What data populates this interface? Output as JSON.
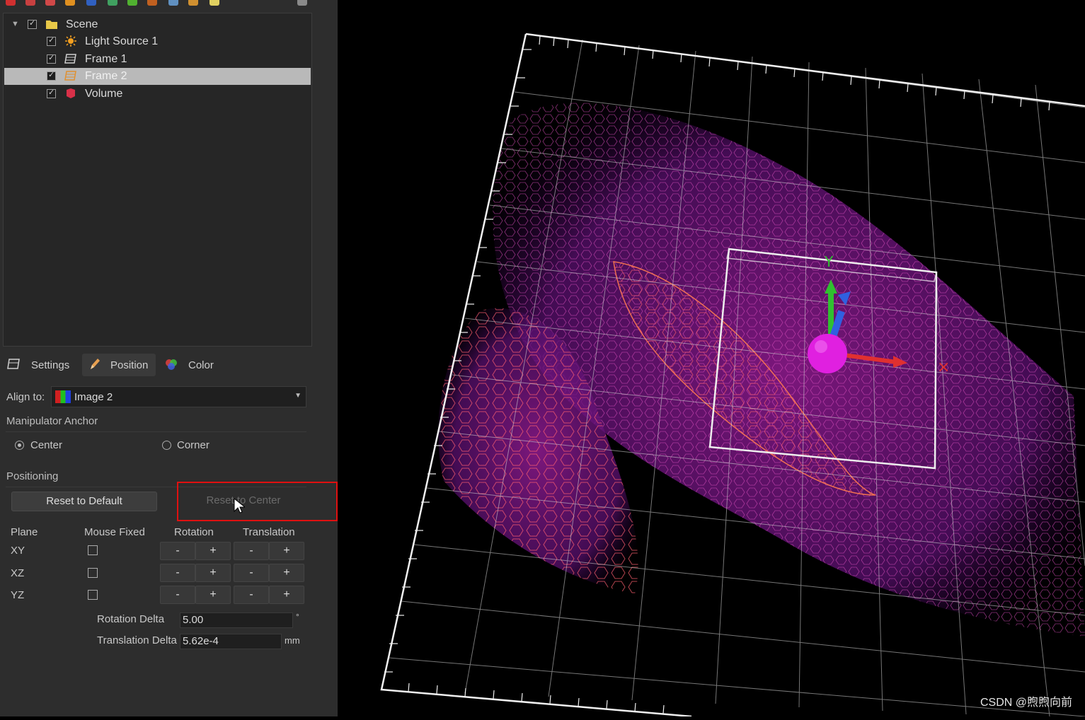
{
  "scene_tree": {
    "items": [
      {
        "label": "Scene",
        "checked": true,
        "icon": "folder-icon"
      },
      {
        "label": "Light Source 1",
        "checked": true,
        "icon": "light-source-icon"
      },
      {
        "label": "Frame 1",
        "checked": true,
        "icon": "frame-icon"
      },
      {
        "label": "Frame 2",
        "checked": true,
        "icon": "frame-icon",
        "selected": true
      },
      {
        "label": "Volume",
        "checked": true,
        "icon": "volume-icon"
      }
    ]
  },
  "tabs": [
    {
      "label": "Settings",
      "icon": "settings-icon"
    },
    {
      "label": "Position",
      "icon": "pencil-icon",
      "active": true
    },
    {
      "label": "Color",
      "icon": "color-wheel-icon"
    }
  ],
  "align": {
    "label": "Align to:",
    "value": "Image 2"
  },
  "anchor": {
    "title": "Manipulator Anchor",
    "options": [
      "Center",
      "Corner"
    ],
    "selected": "Center"
  },
  "positioning": {
    "title": "Positioning",
    "reset_default": "Reset to Default",
    "reset_center": "Reset to Center",
    "headers": [
      "Plane",
      "Mouse Fixed",
      "Rotation",
      "Translation"
    ],
    "planes": [
      "XY",
      "XZ",
      "YZ"
    ],
    "minus": "-",
    "plus": "+",
    "rotation_delta_label": "Rotation Delta",
    "rotation_delta_value": "5.00",
    "rotation_delta_unit": "°",
    "translation_delta_label": "Translation Delta",
    "translation_delta_value": "5.62e-4",
    "translation_delta_unit": "mm"
  },
  "viewport": {
    "axis_label_y": "Y"
  },
  "watermark": "CSDN @煦煦向前",
  "colors": {
    "highlight": "#e01010",
    "selection": "#b9b9b9",
    "magenta": "#e020e0"
  }
}
